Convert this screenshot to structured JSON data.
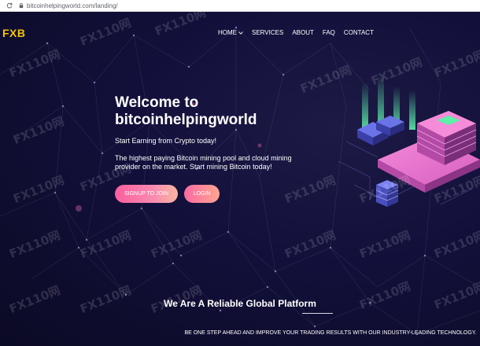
{
  "browser": {
    "url": "bitcoinhelpingworld.com/landing/",
    "reload_icon": "reload-icon",
    "lock_icon": "lock-icon"
  },
  "header": {
    "logo": "FXB",
    "nav": [
      {
        "label": "HOME",
        "has_dropdown": true
      },
      {
        "label": "SERVICES"
      },
      {
        "label": "ABOUT"
      },
      {
        "label": "FAQ"
      },
      {
        "label": "CONTACT"
      }
    ]
  },
  "hero": {
    "title_prefix": "Welcome",
    "title_connector": "to",
    "title_site": "bitcoinhelpingworld",
    "subtitle": "Start Earning from Crypto today!",
    "description": "The highest paying Bitcoin mining pool and cloud mining provider on the market. Start mining Bitcoin today!",
    "signup_button": "SIGNUP TO JOIN",
    "login_button": "LOGIN"
  },
  "platform_section": {
    "title": "We Are A Reliable Global Platform",
    "text": "BE ONE STEP AHEAD AND IMPROVE YOUR TRADING RESULTS WITH OUR INDUSTRY-LEADING TECHNOLOGY."
  },
  "watermark": "FX110网",
  "colors": {
    "background": "#0e0c2c",
    "logo": "#f4c20d",
    "button_pink": "#fb5e9e",
    "button_peach": "#fca58f",
    "server_accent": "#f06bd0",
    "glow_green": "#5cf0a8"
  }
}
